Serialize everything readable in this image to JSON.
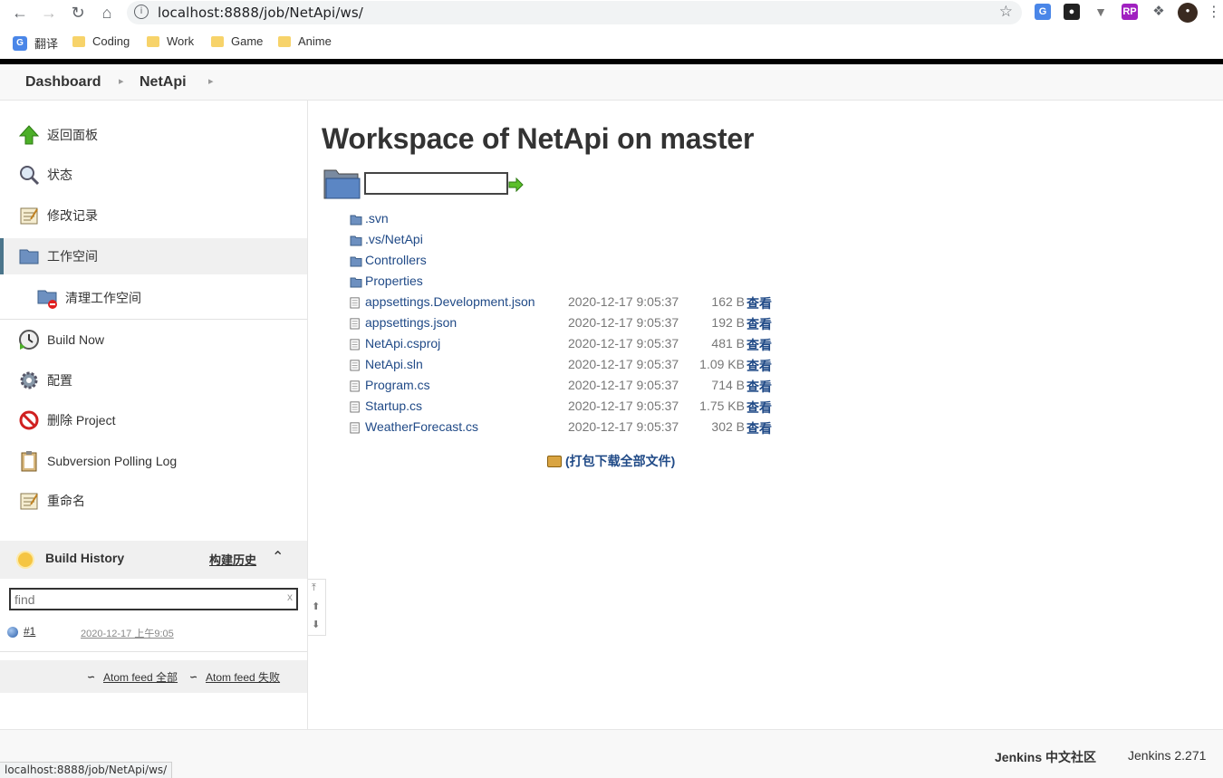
{
  "browser": {
    "url": "localhost:8888/job/NetApi/ws/",
    "bookmarks": [
      "翻译",
      "Coding",
      "Work",
      "Game",
      "Anime"
    ],
    "status_url": "localhost:8888/job/NetApi/ws/"
  },
  "breadcrumb": [
    "Dashboard",
    "NetApi"
  ],
  "sidebar": {
    "tasks": [
      {
        "label": "返回面板",
        "icon": "up-arrow-icon"
      },
      {
        "label": "状态",
        "icon": "magnifier-icon"
      },
      {
        "label": "修改记录",
        "icon": "notepad-icon"
      },
      {
        "label": "工作空间",
        "icon": "folder-icon",
        "active": true
      },
      {
        "label": "清理工作空间",
        "icon": "folder-delete-icon"
      },
      {
        "label": "Build Now",
        "icon": "clock-icon"
      },
      {
        "label": "配置",
        "icon": "gear-icon"
      },
      {
        "label": "删除 Project",
        "icon": "no-entry-icon"
      },
      {
        "label": "Subversion Polling Log",
        "icon": "clipboard-icon"
      },
      {
        "label": "重命名",
        "icon": "notepad-icon"
      }
    ],
    "build_history": {
      "title": "Build History",
      "trend_label": "构建历史",
      "find_placeholder": "find",
      "clear": "x",
      "builds": [
        {
          "number": "#1",
          "time": "2020-12-17 上午9:05",
          "status_color": "#2a5faa"
        }
      ],
      "feed_all": "Atom feed 全部",
      "feed_failed": "Atom feed 失败"
    }
  },
  "main": {
    "title": "Workspace of NetApi on master",
    "path_value": "",
    "entries": [
      {
        "name": ".svn",
        "type": "dir"
      },
      {
        "name": ".vs/NetApi",
        "type": "dir"
      },
      {
        "name": "Controllers",
        "type": "dir"
      },
      {
        "name": "Properties",
        "type": "dir"
      },
      {
        "name": "appsettings.Development.json",
        "type": "file",
        "date": "2020-12-17 9:05:37",
        "size": "162 B",
        "view": "查看"
      },
      {
        "name": "appsettings.json",
        "type": "file",
        "date": "2020-12-17 9:05:37",
        "size": "192 B",
        "view": "查看"
      },
      {
        "name": "NetApi.csproj",
        "type": "file",
        "date": "2020-12-17 9:05:37",
        "size": "481 B",
        "view": "查看"
      },
      {
        "name": "NetApi.sln",
        "type": "file",
        "date": "2020-12-17 9:05:37",
        "size": "1.09 KB",
        "view": "查看"
      },
      {
        "name": "Program.cs",
        "type": "file",
        "date": "2020-12-17 9:05:37",
        "size": "714 B",
        "view": "查看"
      },
      {
        "name": "Startup.cs",
        "type": "file",
        "date": "2020-12-17 9:05:37",
        "size": "1.75 KB",
        "view": "查看"
      },
      {
        "name": "WeatherForecast.cs",
        "type": "file",
        "date": "2020-12-17 9:05:37",
        "size": "302 B",
        "view": "查看"
      }
    ],
    "zip_label": "(打包下载全部文件)"
  },
  "footer": {
    "community": "Jenkins 中文社区",
    "version": "Jenkins 2.271"
  },
  "colors": {
    "link": "#204a87",
    "active_border": "#4b758b"
  }
}
